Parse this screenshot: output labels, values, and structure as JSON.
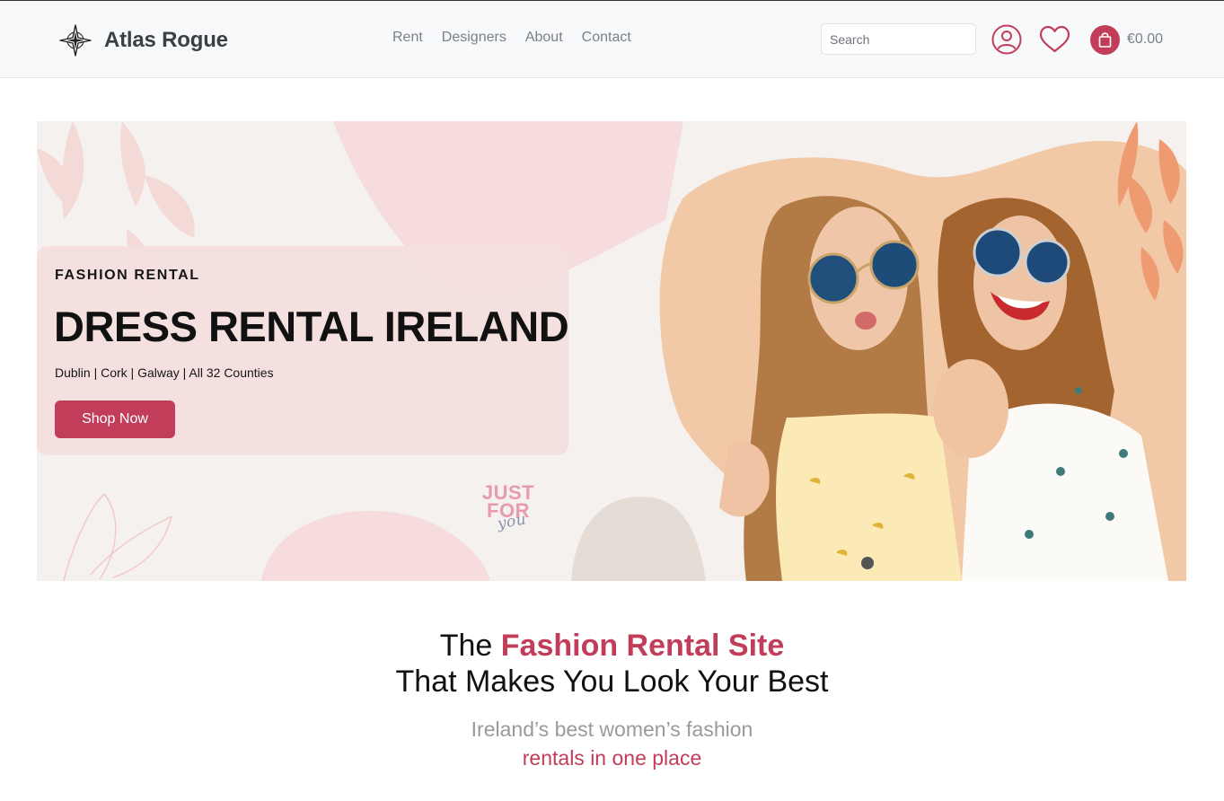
{
  "brand": {
    "name": "Atlas Rogue",
    "logo_icon": "compass-star-icon"
  },
  "nav": {
    "links": [
      {
        "label": "Rent"
      },
      {
        "label": "Designers"
      },
      {
        "label": "About"
      },
      {
        "label": "Contact"
      }
    ]
  },
  "search": {
    "placeholder": "Search",
    "value": ""
  },
  "header_icons": {
    "account": "user-icon",
    "wishlist": "heart-icon",
    "cart": "shopping-bag-icon"
  },
  "cart": {
    "total": "€0.00"
  },
  "hero": {
    "eyebrow": "FASHION RENTAL",
    "title": "DRESS RENTAL IRELAND",
    "locations": "Dublin | Cork | Galway | All 32 Counties",
    "cta_label": "Shop Now",
    "badge_line1": "JUST",
    "badge_line2": "FOR",
    "badge_line3": "you",
    "image_alt": "two-women-sunglasses-photo"
  },
  "tagline": {
    "prefix": "The ",
    "highlight": "Fashion Rental Site",
    "line2": "That Makes You Look Your Best",
    "sub_line1": "Ireland’s best women’s fashion",
    "sub_line2": "rentals in one place"
  },
  "colors": {
    "accent": "#c23d5a",
    "nav_bg": "#f8f9fa",
    "hero_card": "#f4dede",
    "hero_peach": "#f2c9a6"
  }
}
